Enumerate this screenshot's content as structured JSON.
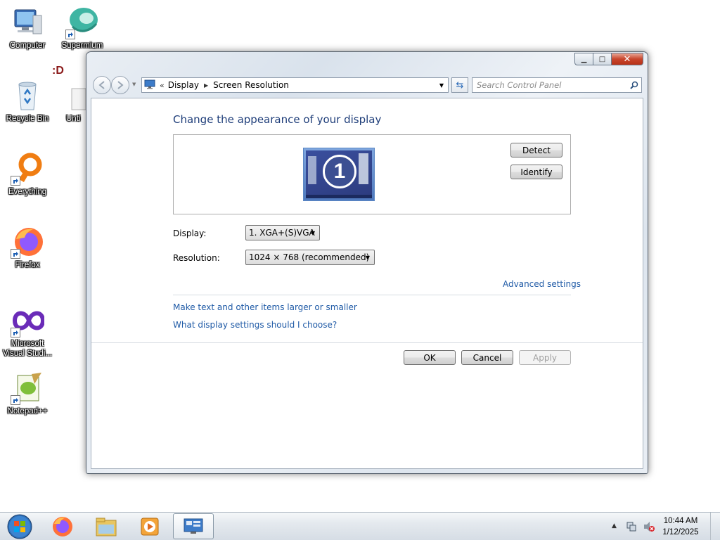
{
  "desktop": {
    "icons": [
      {
        "label": "Computer"
      },
      {
        "label": "Supermium"
      },
      {
        "label": "Recycle Bin"
      },
      {
        "label": "Unti"
      },
      {
        "label": "Everything"
      },
      {
        "label": "Firefox"
      },
      {
        "label": "Microsoft Visual Studi..."
      },
      {
        "label": "Notepad++"
      }
    ],
    "smiley": ":D"
  },
  "window": {
    "controls": {
      "minimize": "▁",
      "maximize": "□",
      "close": "✕"
    },
    "address": {
      "chevron": "«",
      "crumbs": [
        "Display",
        "Screen Resolution"
      ]
    },
    "search": {
      "placeholder": "Search Control Panel"
    },
    "title": "Change the appearance of your display",
    "monitor_number": "1",
    "buttons": {
      "detect": "Detect",
      "identify": "Identify",
      "ok": "OK",
      "cancel": "Cancel",
      "apply": "Apply"
    },
    "display_label": "Display:",
    "display_value": "1. XGA+(S)VGA",
    "resolution_label": "Resolution:",
    "resolution_value": "1024 × 768 (recommended)",
    "links": {
      "advanced": "Advanced settings",
      "text_size": "Make text and other items larger or smaller",
      "which_settings": "What display settings should I choose?"
    }
  },
  "taskbar": {
    "clock_time": "10:44 AM",
    "clock_date": "1/12/2025"
  },
  "colors": {
    "link": "#1f5aa6",
    "title": "#1e3d79",
    "close_button": "#c8452c"
  }
}
